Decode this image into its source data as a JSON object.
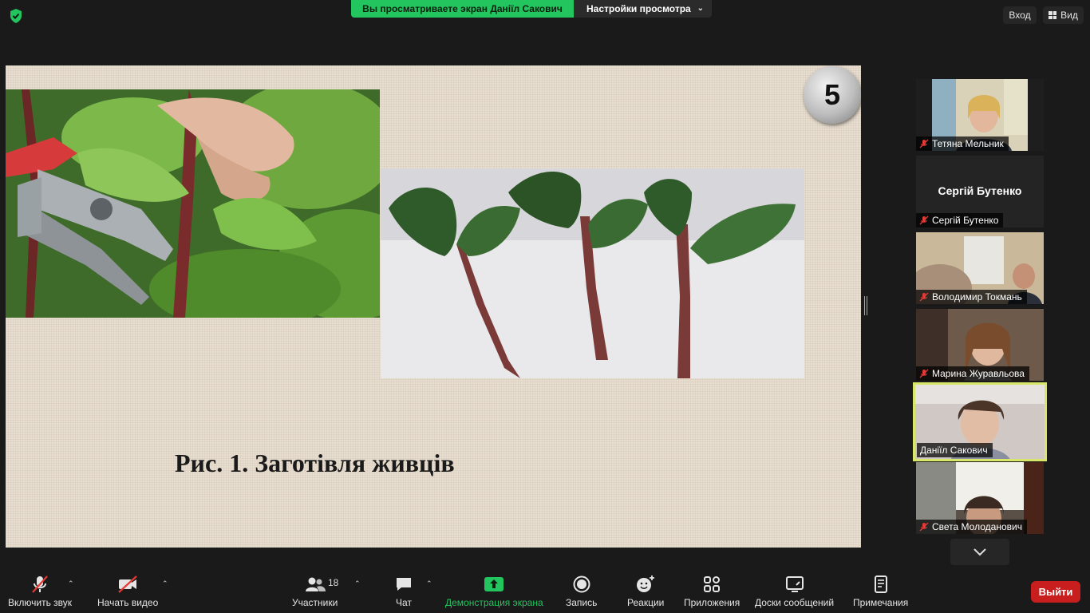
{
  "topbar": {
    "share_status": "Вы просматриваете экран Даніїл Сакович",
    "view_options": "Настройки просмотра",
    "enter_label": "Вход",
    "view_label": "Вид"
  },
  "slide": {
    "number": "5",
    "caption": "Рис. 1. Заготівля живців"
  },
  "participants": [
    {
      "name": "Тетяна Мельник",
      "muted": true,
      "video": true
    },
    {
      "name": "Сергій Бутенко",
      "display_name": "Сергій Бутенко",
      "muted": true,
      "video": false
    },
    {
      "name": "Володимир Токмань",
      "muted": true,
      "video": true
    },
    {
      "name": "Марина Журавльова",
      "muted": true,
      "video": true
    },
    {
      "name": "Даніїл Сакович",
      "muted": false,
      "video": true,
      "active_speaker": true
    },
    {
      "name": "Света Молоданович",
      "muted": true,
      "video": true
    }
  ],
  "toolbar": {
    "unmute_label": "Включить звук",
    "start_video_label": "Начать видео",
    "participants_label": "Участники",
    "participants_count": "18",
    "chat_label": "Чат",
    "share_screen_label": "Демонстрация экрана",
    "record_label": "Запись",
    "reactions_label": "Реакции",
    "apps_label": "Приложения",
    "whiteboards_label": "Доски сообщений",
    "notes_label": "Примечания",
    "leave_label": "Выйти"
  },
  "colors": {
    "share_green": "#22c55e",
    "leave_red": "#c81e1e",
    "active_speaker_outline": "#d8e66a",
    "mute_red": "#e53935"
  }
}
